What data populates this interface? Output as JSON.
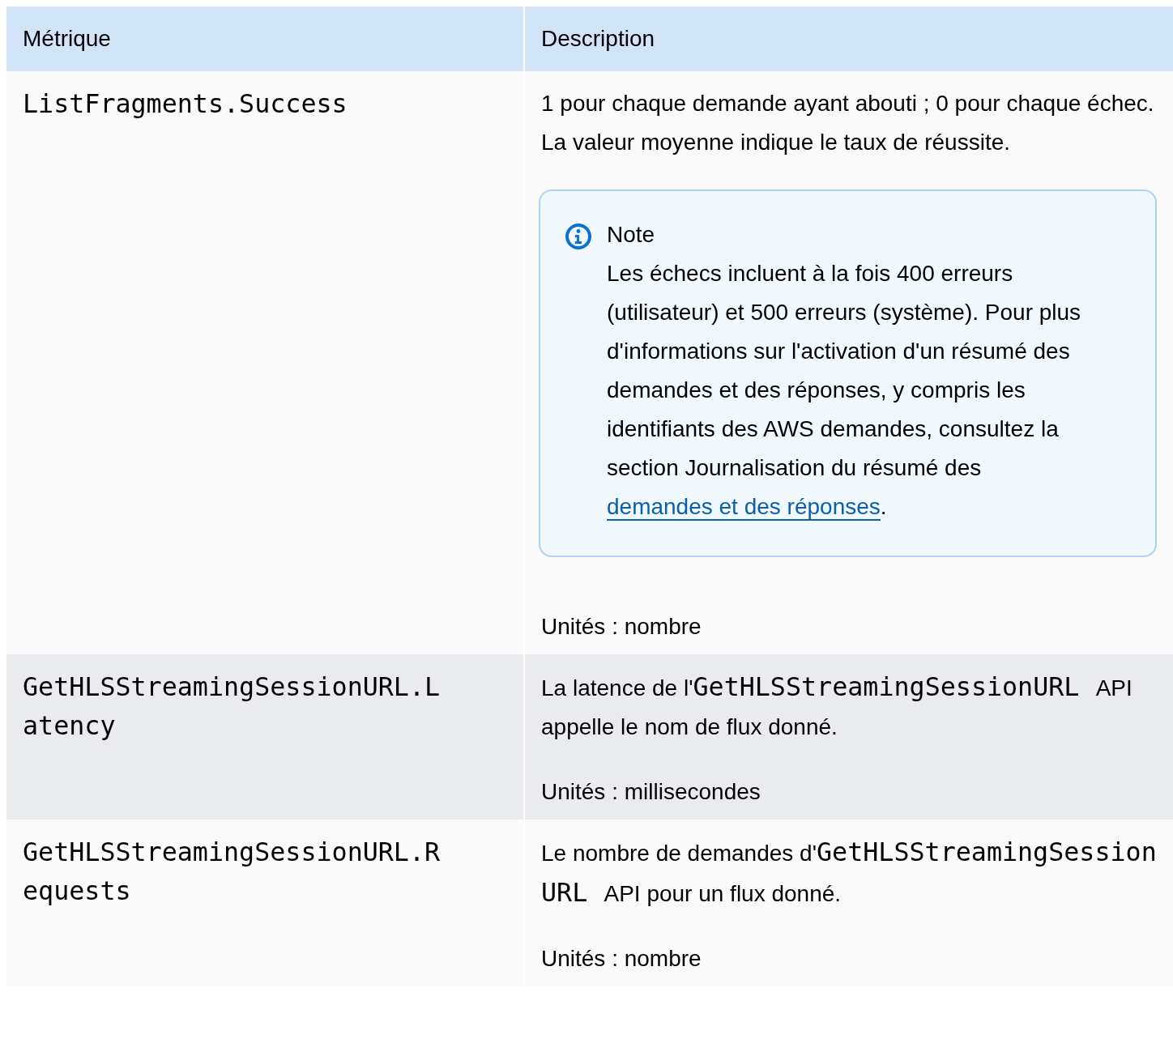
{
  "table": {
    "columns": [
      "Métrique",
      "Description"
    ],
    "rows": [
      {
        "metric": "ListFragments.Success",
        "shaded": false,
        "description": [
          {
            "kind": "paragraph",
            "segments": [
              {
                "kind": "text",
                "text": "1 pour chaque demande ayant abouti ; 0 pour chaque échec. La valeur moyenne indique le taux de réussite."
              }
            ]
          },
          {
            "kind": "note",
            "title": "Note",
            "segments": [
              {
                "kind": "text",
                "text": "Les échecs incluent à la fois 400 erreurs (utilisateur) et 500 erreurs (système). Pour plus d'informations sur l'activation d'un résumé des demandes et des réponses, y compris les identifiants des AWS demandes, consultez la section Journalisation du résumé des "
              },
              {
                "kind": "link",
                "text": "demandes et des réponses"
              },
              {
                "kind": "text",
                "text": "."
              }
            ]
          },
          {
            "kind": "paragraph",
            "segments": [
              {
                "kind": "text",
                "text": "Unités : nombre"
              }
            ]
          }
        ]
      },
      {
        "metric": "GetHLSStreamingSessionURL.Latency",
        "shaded": true,
        "description": [
          {
            "kind": "paragraph",
            "segments": [
              {
                "kind": "text",
                "text": "La latence de l'"
              },
              {
                "kind": "code",
                "text": "GetHLSStreamingSessionURL"
              },
              {
                "kind": "text",
                "text": " API appelle le nom de flux donné."
              }
            ]
          },
          {
            "kind": "paragraph",
            "segments": [
              {
                "kind": "text",
                "text": "Unités : millisecondes"
              }
            ]
          }
        ]
      },
      {
        "metric": "GetHLSStreamingSessionURL.Requests",
        "shaded": false,
        "description": [
          {
            "kind": "paragraph",
            "segments": [
              {
                "kind": "text",
                "text": "Le nombre de demandes d'"
              },
              {
                "kind": "code",
                "text": "GetHLSStreamingSessionURL"
              },
              {
                "kind": "text",
                "text": " API pour un flux donné."
              }
            ]
          },
          {
            "kind": "paragraph",
            "segments": [
              {
                "kind": "text",
                "text": "Unités : nombre"
              }
            ]
          }
        ]
      }
    ]
  }
}
